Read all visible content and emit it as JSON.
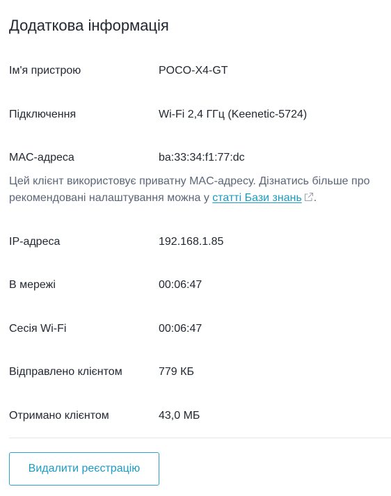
{
  "section": {
    "title": "Додаткова інформація"
  },
  "details": [
    {
      "label": "Ім'я пристрою",
      "value": "POCO-X4-GT"
    },
    {
      "label": "Підключення",
      "value": "Wi-Fi 2,4 ГГц (Keenetic-5724)"
    },
    {
      "label": "MAC-адреса",
      "value": "ba:33:34:f1:77:dc"
    },
    {
      "label": "IP-адреса",
      "value": "192.168.1.85"
    },
    {
      "label": "В мережі",
      "value": "00:06:47"
    },
    {
      "label": "Сесія Wi-Fi",
      "value": "00:06:47"
    },
    {
      "label": "Відправлено клієнтом",
      "value": "779 КБ"
    },
    {
      "label": "Отримано клієнтом",
      "value": "43,0 МБ"
    }
  ],
  "mac_note": {
    "text_before_link": "Цей клієнт використовує приватну MAC-адресу. Дізнатись більше про рекомендовані налаштування можна у ",
    "link_text": "статті Бази знань",
    "text_after_link": "."
  },
  "actions": {
    "unregister_label": "Видалити реєстрацію"
  },
  "colors": {
    "accent": "#1a9bc4",
    "note_text": "#5a6678",
    "text": "#222831",
    "divider": "#e3e6ea"
  },
  "icons": {
    "link_icon": "external-link-icon"
  }
}
